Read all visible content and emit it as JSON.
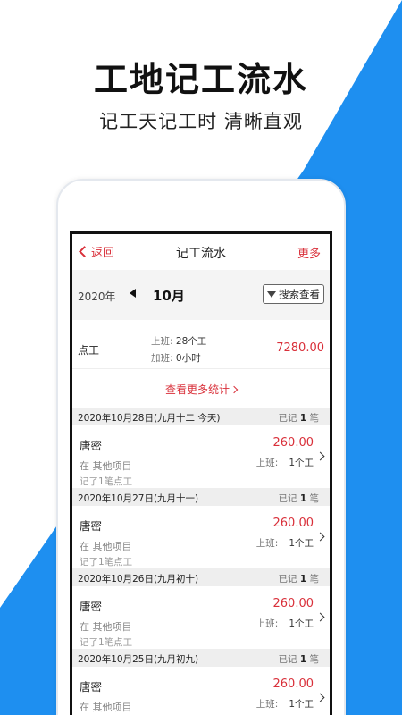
{
  "promo": {
    "title": "工地记工流水",
    "subtitle": "记工天记工时  清晰直观"
  },
  "colors": {
    "accent_blue": "#1e8ff0",
    "accent_red": "#d9303a"
  },
  "nav": {
    "back_label": "返回",
    "title": "记工流水",
    "more_label": "更多"
  },
  "month_bar": {
    "year": "2020年",
    "month": "10月",
    "search_label": "搜索查看"
  },
  "summary": {
    "label": "点工",
    "shift_key": "上班:",
    "shift_value": "28个工",
    "overtime_key": "加班:",
    "overtime_value": "0小时",
    "amount": "7280.00"
  },
  "more_stats_label": "查看更多统计",
  "days": [
    {
      "date": "2020年10月28日(九月十二 今天)",
      "count_prefix": "已记",
      "count": "1",
      "count_suffix": "笔",
      "record": {
        "name": "唐密",
        "project": "在 其他项目",
        "note": "记了1笔点工",
        "amount": "260.00",
        "shift_key": "上班:",
        "shift_value": "1个工"
      }
    },
    {
      "date": "2020年10月27日(九月十一)",
      "count_prefix": "已记",
      "count": "1",
      "count_suffix": "笔",
      "record": {
        "name": "唐密",
        "project": "在 其他项目",
        "note": "记了1笔点工",
        "amount": "260.00",
        "shift_key": "上班:",
        "shift_value": "1个工"
      }
    },
    {
      "date": "2020年10月26日(九月初十)",
      "count_prefix": "已记",
      "count": "1",
      "count_suffix": "笔",
      "record": {
        "name": "唐密",
        "project": "在 其他项目",
        "note": "记了1笔点工",
        "amount": "260.00",
        "shift_key": "上班:",
        "shift_value": "1个工"
      }
    },
    {
      "date": "2020年10月25日(九月初九)",
      "count_prefix": "已记",
      "count": "1",
      "count_suffix": "笔",
      "record": {
        "name": "唐密",
        "project": "在 其他项目",
        "note": "",
        "amount": "260.00",
        "shift_key": "上班:",
        "shift_value": "1个工"
      }
    }
  ]
}
